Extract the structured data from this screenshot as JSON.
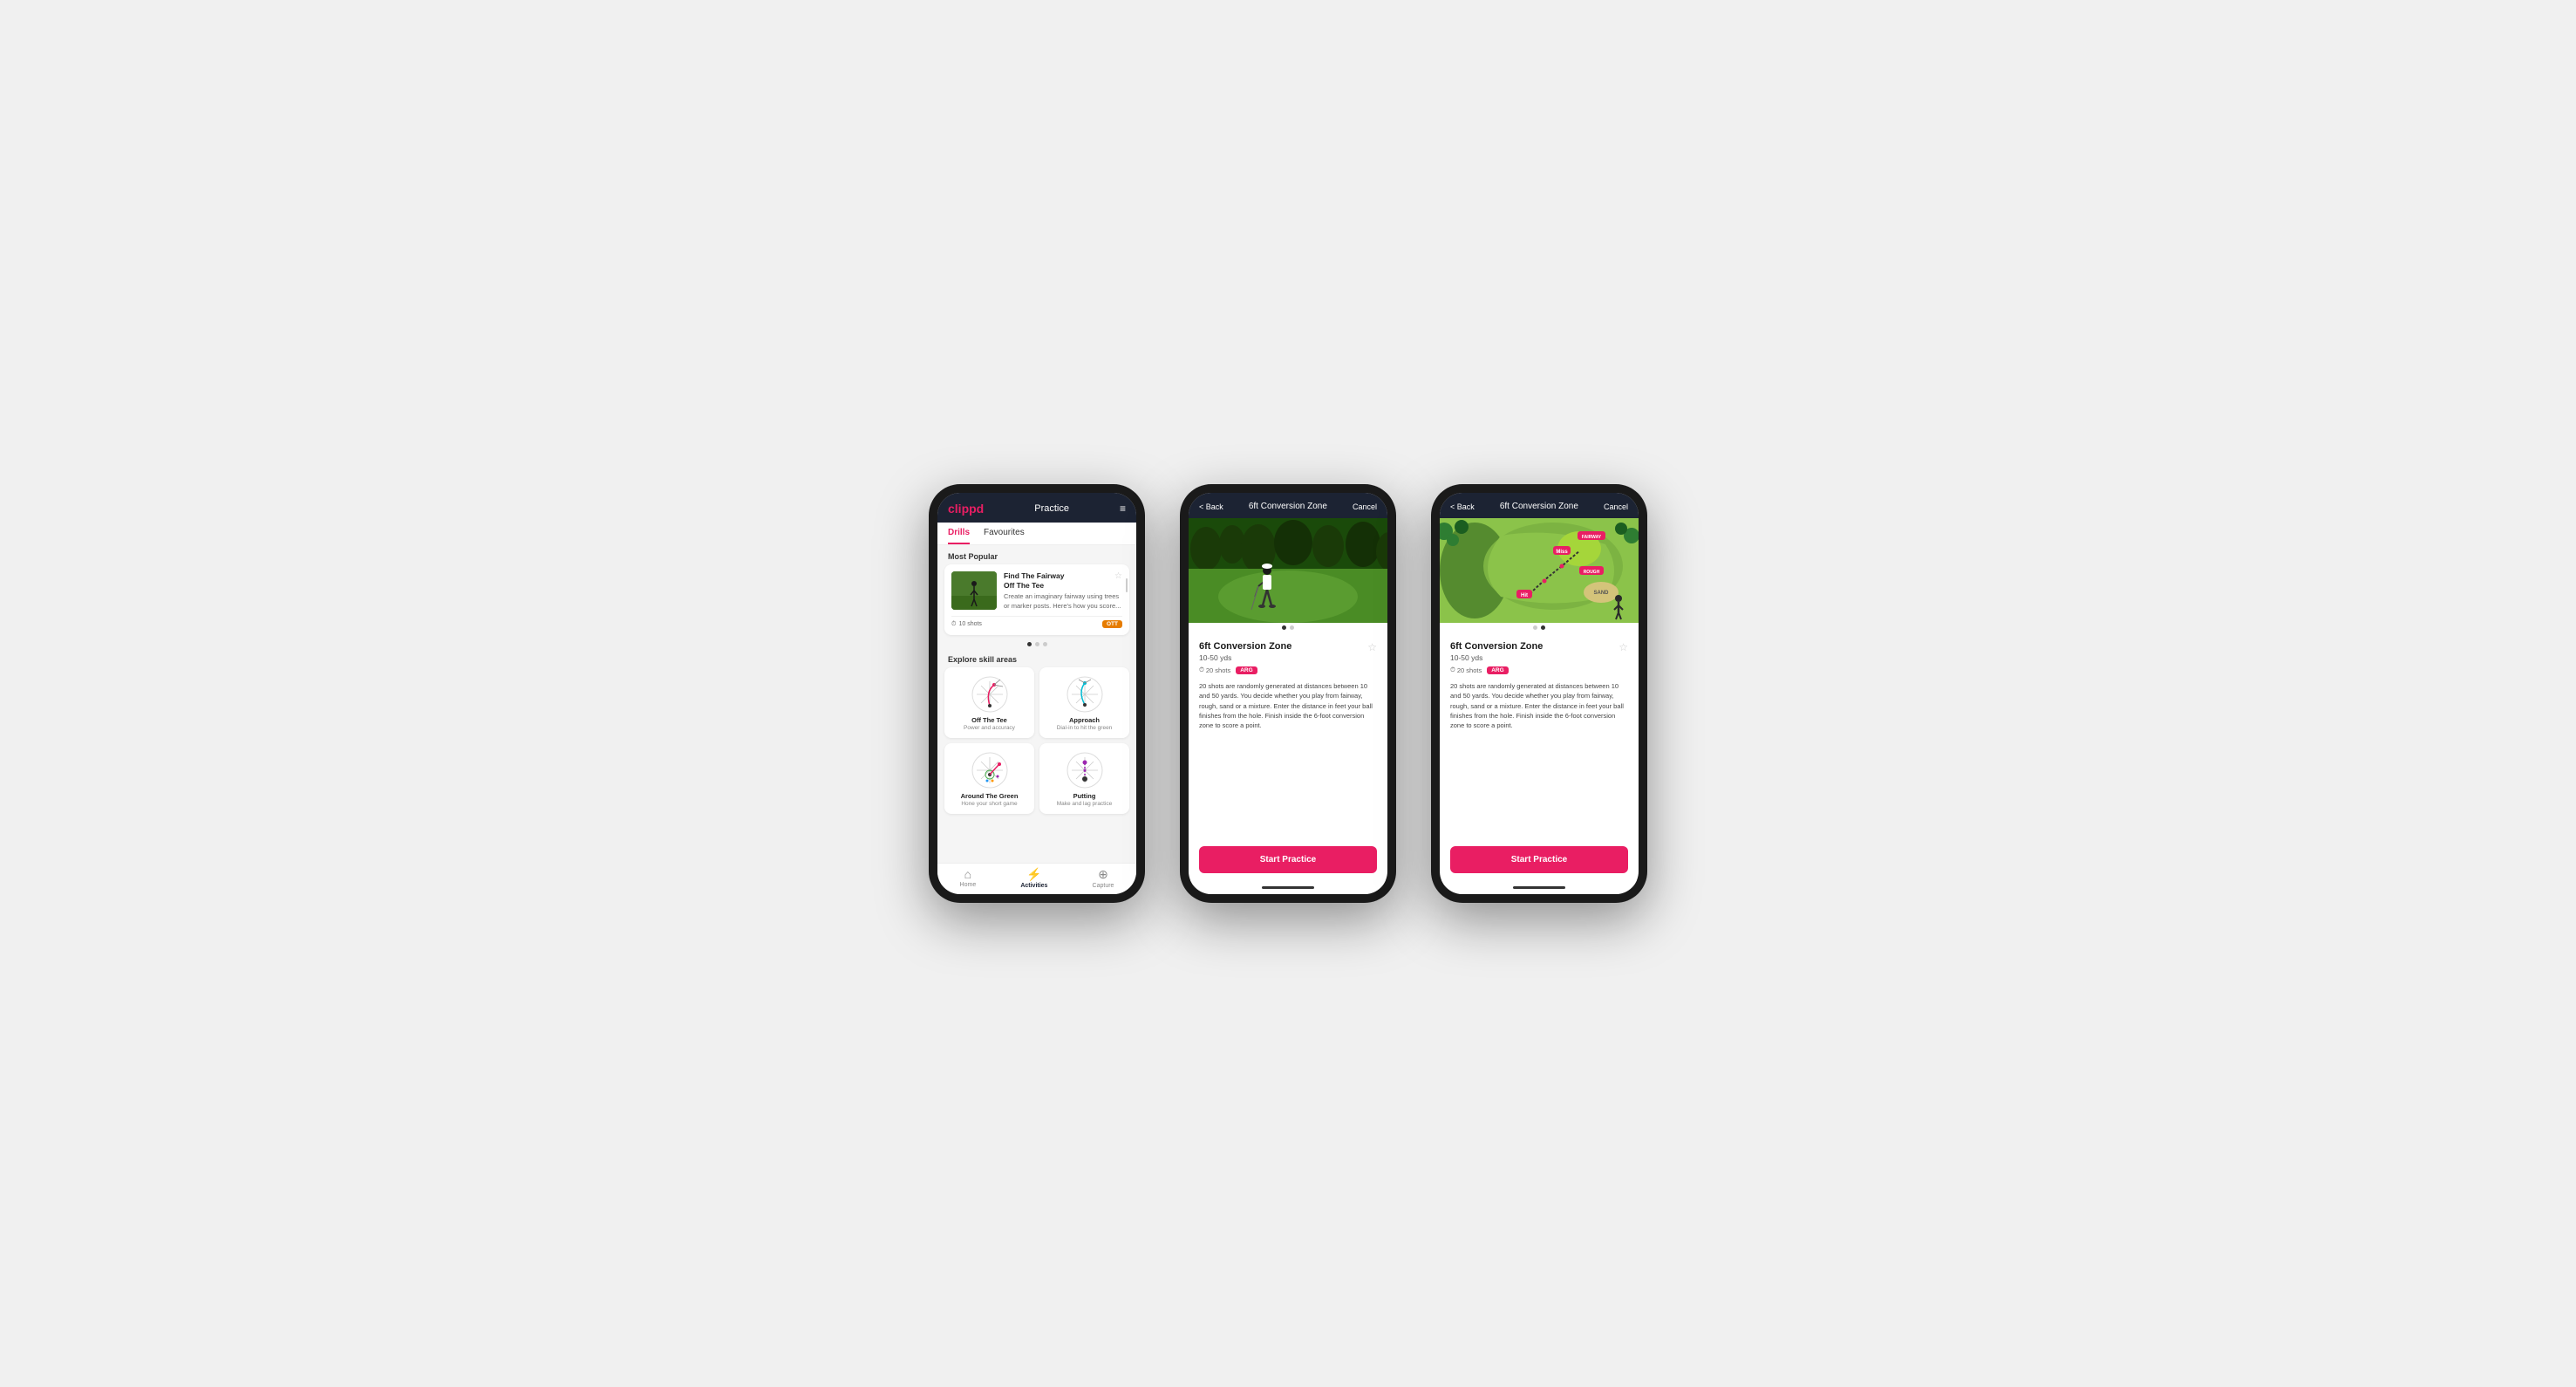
{
  "app": {
    "logo": "clippd",
    "nav_title": "Practice",
    "menu_icon": "≡"
  },
  "phone1": {
    "tabs": [
      {
        "label": "Drills",
        "active": true
      },
      {
        "label": "Favourites",
        "active": false
      }
    ],
    "most_popular_label": "Most Popular",
    "featured_card": {
      "title": "Find The Fairway",
      "subtitle": "Off The Tee",
      "description": "Create an imaginary fairway using trees or marker posts. Here's how you score...",
      "shots": "10 shots",
      "badge": "OTT"
    },
    "explore_label": "Explore skill areas",
    "skill_areas": [
      {
        "name": "Off The Tee",
        "desc": "Power and accuracy"
      },
      {
        "name": "Approach",
        "desc": "Dial-in to hit the green"
      },
      {
        "name": "Around The Green",
        "desc": "Hone your short game"
      },
      {
        "name": "Putting",
        "desc": "Make and lag practice"
      }
    ],
    "bottom_nav": [
      {
        "label": "Home",
        "active": false
      },
      {
        "label": "Activities",
        "active": true
      },
      {
        "label": "Capture",
        "active": false
      }
    ]
  },
  "phone2": {
    "back_label": "< Back",
    "title": "6ft Conversion Zone",
    "cancel_label": "Cancel",
    "drill_title": "6ft Conversion Zone",
    "drill_range": "10-50 yds",
    "shots_count": "20 shots",
    "badge": "ARG",
    "description": "20 shots are randomly generated at distances between 10 and 50 yards. You decide whether you play from fairway, rough, sand or a mixture. Enter the distance in feet your ball finishes from the hole. Finish inside the 6-foot conversion zone to score a point.",
    "start_btn": "Start Practice"
  },
  "phone3": {
    "back_label": "< Back",
    "title": "6ft Conversion Zone",
    "cancel_label": "Cancel",
    "drill_title": "6ft Conversion Zone",
    "drill_range": "10-50 yds",
    "shots_count": "20 shots",
    "badge": "ARG",
    "description": "20 shots are randomly generated at distances between 10 and 50 yards. You decide whether you play from fairway, rough, sand or a mixture. Enter the distance in feet your ball finishes from the hole. Finish inside the 6-foot conversion zone to score a point.",
    "start_btn": "Start Practice",
    "map_labels": {
      "fairway": "FAIRWAY",
      "rough": "ROUGH",
      "hit": "Hit",
      "miss": "Miss",
      "sand": "SAND"
    }
  }
}
